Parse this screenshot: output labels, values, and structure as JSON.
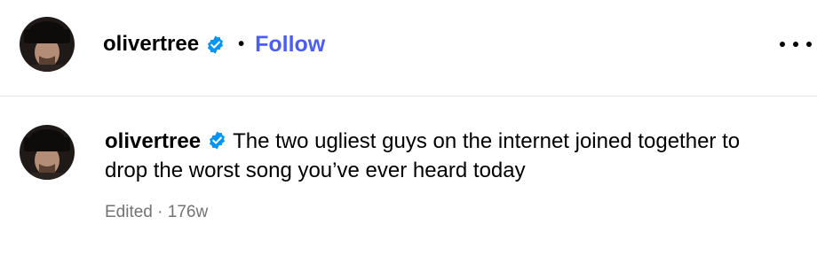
{
  "post_header": {
    "username": "olivertree",
    "verified_icon": "verified-badge-icon",
    "separator": "•",
    "follow_label": "Follow",
    "more_icon": "more-options-icon"
  },
  "caption": {
    "username": "olivertree",
    "text": "The two ugliest guys on the internet joined together to drop the worst song you’ve ever heard today"
  },
  "meta": {
    "edited": "Edited",
    "sep": "·",
    "age": "176w"
  },
  "colors": {
    "follow": "#4a5df9",
    "verified": "#0095f6",
    "meta_text": "#737373"
  }
}
